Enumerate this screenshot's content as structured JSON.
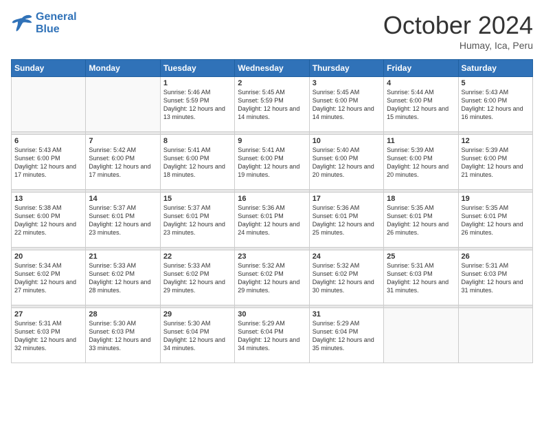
{
  "header": {
    "logo_general": "General",
    "logo_blue": "Blue",
    "month_title": "October 2024",
    "location": "Humay, Ica, Peru"
  },
  "weekdays": [
    "Sunday",
    "Monday",
    "Tuesday",
    "Wednesday",
    "Thursday",
    "Friday",
    "Saturday"
  ],
  "weeks": [
    [
      {
        "day": "",
        "info": ""
      },
      {
        "day": "",
        "info": ""
      },
      {
        "day": "1",
        "info": "Sunrise: 5:46 AM\nSunset: 5:59 PM\nDaylight: 12 hours\nand 13 minutes."
      },
      {
        "day": "2",
        "info": "Sunrise: 5:45 AM\nSunset: 5:59 PM\nDaylight: 12 hours\nand 14 minutes."
      },
      {
        "day": "3",
        "info": "Sunrise: 5:45 AM\nSunset: 6:00 PM\nDaylight: 12 hours\nand 14 minutes."
      },
      {
        "day": "4",
        "info": "Sunrise: 5:44 AM\nSunset: 6:00 PM\nDaylight: 12 hours\nand 15 minutes."
      },
      {
        "day": "5",
        "info": "Sunrise: 5:43 AM\nSunset: 6:00 PM\nDaylight: 12 hours\nand 16 minutes."
      }
    ],
    [
      {
        "day": "6",
        "info": "Sunrise: 5:43 AM\nSunset: 6:00 PM\nDaylight: 12 hours\nand 17 minutes."
      },
      {
        "day": "7",
        "info": "Sunrise: 5:42 AM\nSunset: 6:00 PM\nDaylight: 12 hours\nand 17 minutes."
      },
      {
        "day": "8",
        "info": "Sunrise: 5:41 AM\nSunset: 6:00 PM\nDaylight: 12 hours\nand 18 minutes."
      },
      {
        "day": "9",
        "info": "Sunrise: 5:41 AM\nSunset: 6:00 PM\nDaylight: 12 hours\nand 19 minutes."
      },
      {
        "day": "10",
        "info": "Sunrise: 5:40 AM\nSunset: 6:00 PM\nDaylight: 12 hours\nand 20 minutes."
      },
      {
        "day": "11",
        "info": "Sunrise: 5:39 AM\nSunset: 6:00 PM\nDaylight: 12 hours\nand 20 minutes."
      },
      {
        "day": "12",
        "info": "Sunrise: 5:39 AM\nSunset: 6:00 PM\nDaylight: 12 hours\nand 21 minutes."
      }
    ],
    [
      {
        "day": "13",
        "info": "Sunrise: 5:38 AM\nSunset: 6:00 PM\nDaylight: 12 hours\nand 22 minutes."
      },
      {
        "day": "14",
        "info": "Sunrise: 5:37 AM\nSunset: 6:01 PM\nDaylight: 12 hours\nand 23 minutes."
      },
      {
        "day": "15",
        "info": "Sunrise: 5:37 AM\nSunset: 6:01 PM\nDaylight: 12 hours\nand 23 minutes."
      },
      {
        "day": "16",
        "info": "Sunrise: 5:36 AM\nSunset: 6:01 PM\nDaylight: 12 hours\nand 24 minutes."
      },
      {
        "day": "17",
        "info": "Sunrise: 5:36 AM\nSunset: 6:01 PM\nDaylight: 12 hours\nand 25 minutes."
      },
      {
        "day": "18",
        "info": "Sunrise: 5:35 AM\nSunset: 6:01 PM\nDaylight: 12 hours\nand 26 minutes."
      },
      {
        "day": "19",
        "info": "Sunrise: 5:35 AM\nSunset: 6:01 PM\nDaylight: 12 hours\nand 26 minutes."
      }
    ],
    [
      {
        "day": "20",
        "info": "Sunrise: 5:34 AM\nSunset: 6:02 PM\nDaylight: 12 hours\nand 27 minutes."
      },
      {
        "day": "21",
        "info": "Sunrise: 5:33 AM\nSunset: 6:02 PM\nDaylight: 12 hours\nand 28 minutes."
      },
      {
        "day": "22",
        "info": "Sunrise: 5:33 AM\nSunset: 6:02 PM\nDaylight: 12 hours\nand 29 minutes."
      },
      {
        "day": "23",
        "info": "Sunrise: 5:32 AM\nSunset: 6:02 PM\nDaylight: 12 hours\nand 29 minutes."
      },
      {
        "day": "24",
        "info": "Sunrise: 5:32 AM\nSunset: 6:02 PM\nDaylight: 12 hours\nand 30 minutes."
      },
      {
        "day": "25",
        "info": "Sunrise: 5:31 AM\nSunset: 6:03 PM\nDaylight: 12 hours\nand 31 minutes."
      },
      {
        "day": "26",
        "info": "Sunrise: 5:31 AM\nSunset: 6:03 PM\nDaylight: 12 hours\nand 31 minutes."
      }
    ],
    [
      {
        "day": "27",
        "info": "Sunrise: 5:31 AM\nSunset: 6:03 PM\nDaylight: 12 hours\nand 32 minutes."
      },
      {
        "day": "28",
        "info": "Sunrise: 5:30 AM\nSunset: 6:03 PM\nDaylight: 12 hours\nand 33 minutes."
      },
      {
        "day": "29",
        "info": "Sunrise: 5:30 AM\nSunset: 6:04 PM\nDaylight: 12 hours\nand 34 minutes."
      },
      {
        "day": "30",
        "info": "Sunrise: 5:29 AM\nSunset: 6:04 PM\nDaylight: 12 hours\nand 34 minutes."
      },
      {
        "day": "31",
        "info": "Sunrise: 5:29 AM\nSunset: 6:04 PM\nDaylight: 12 hours\nand 35 minutes."
      },
      {
        "day": "",
        "info": ""
      },
      {
        "day": "",
        "info": ""
      }
    ]
  ]
}
